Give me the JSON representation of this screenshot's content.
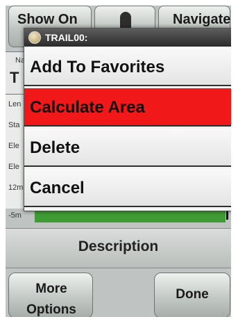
{
  "header": {
    "show_on_label": "Show On",
    "navigate_label": "Navigate"
  },
  "trail": {
    "name_label": "Na",
    "name_value": "T"
  },
  "stats": {
    "labels": [
      "Len",
      "Sta",
      "Ele",
      "Ele",
      "12m"
    ]
  },
  "graph": {
    "axis_label": "-5m",
    "bar_color": "#3f9c35"
  },
  "description_button": "Description",
  "bottom": {
    "more_options_label": "More Options",
    "done_label": "Done"
  },
  "menu": {
    "title": "TRAIL00:",
    "icon": "trail-icon",
    "highlight_color": "#f01818",
    "items": [
      {
        "label": "Add To Favorites"
      },
      {
        "label": "Calculate Area"
      },
      {
        "label": "Delete"
      },
      {
        "label": "Cancel"
      }
    ],
    "selected_index": 1
  }
}
